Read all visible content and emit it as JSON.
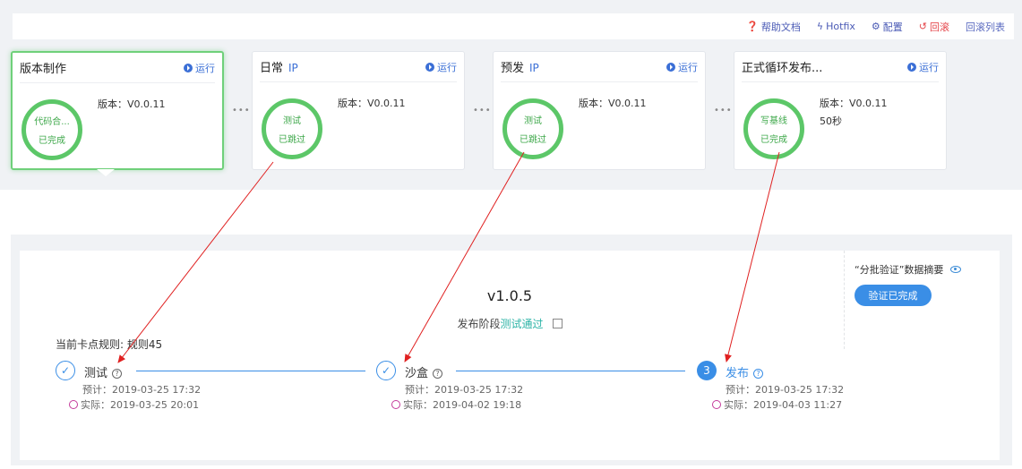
{
  "toolbar": {
    "help": "帮助文档",
    "hotfix": "Hotfix",
    "config": "配置",
    "rollback": "回滚",
    "rollback_list": "回滚列表"
  },
  "cards": [
    {
      "title": "版本制作",
      "ip": "",
      "run": "运行",
      "ring_line1": "代码合...",
      "ring_line2": "已完成",
      "version": "版本：V0.0.11",
      "extra": ""
    },
    {
      "title": "日常",
      "ip": "IP",
      "run": "运行",
      "ring_line1": "测试",
      "ring_line2": "已跳过",
      "version": "版本：V0.0.11",
      "extra": ""
    },
    {
      "title": "预发",
      "ip": "IP",
      "run": "运行",
      "ring_line1": "测试",
      "ring_line2": "已跳过",
      "version": "版本：V0.0.11",
      "extra": ""
    },
    {
      "title": "正式循环发布...",
      "ip": "",
      "run": "运行",
      "ring_line1": "写基线",
      "ring_line2": "已完成",
      "version": "版本：V0.0.11",
      "extra": "50秒"
    }
  ],
  "separator": "•••",
  "detail": {
    "version": "v1.0.5",
    "stage_prefix": "发布阶段",
    "stage_value": "测试通过",
    "summary_title": "“分批验证”数据摘要",
    "verify_button": "验证已完成",
    "rule": "当前卡点规则: 规则45"
  },
  "steps": [
    {
      "icon": "✓",
      "name": "测试",
      "planned": "预计：2019-03-25 17:32",
      "actual": "实际：2019-03-25 20:01"
    },
    {
      "icon": "✓",
      "name": "沙盒",
      "planned": "预计：2019-03-25 17:32",
      "actual": "实际：2019-04-02 19:18"
    },
    {
      "icon": "3",
      "name": "发布",
      "planned": "预计：2019-03-25 17:32",
      "actual": "实际：2019-04-03 11:27"
    }
  ],
  "colors": {
    "accent": "#3a8ee6",
    "success": "#5cc768",
    "arrow": "#e02020",
    "pass": "#2bb3a6"
  }
}
